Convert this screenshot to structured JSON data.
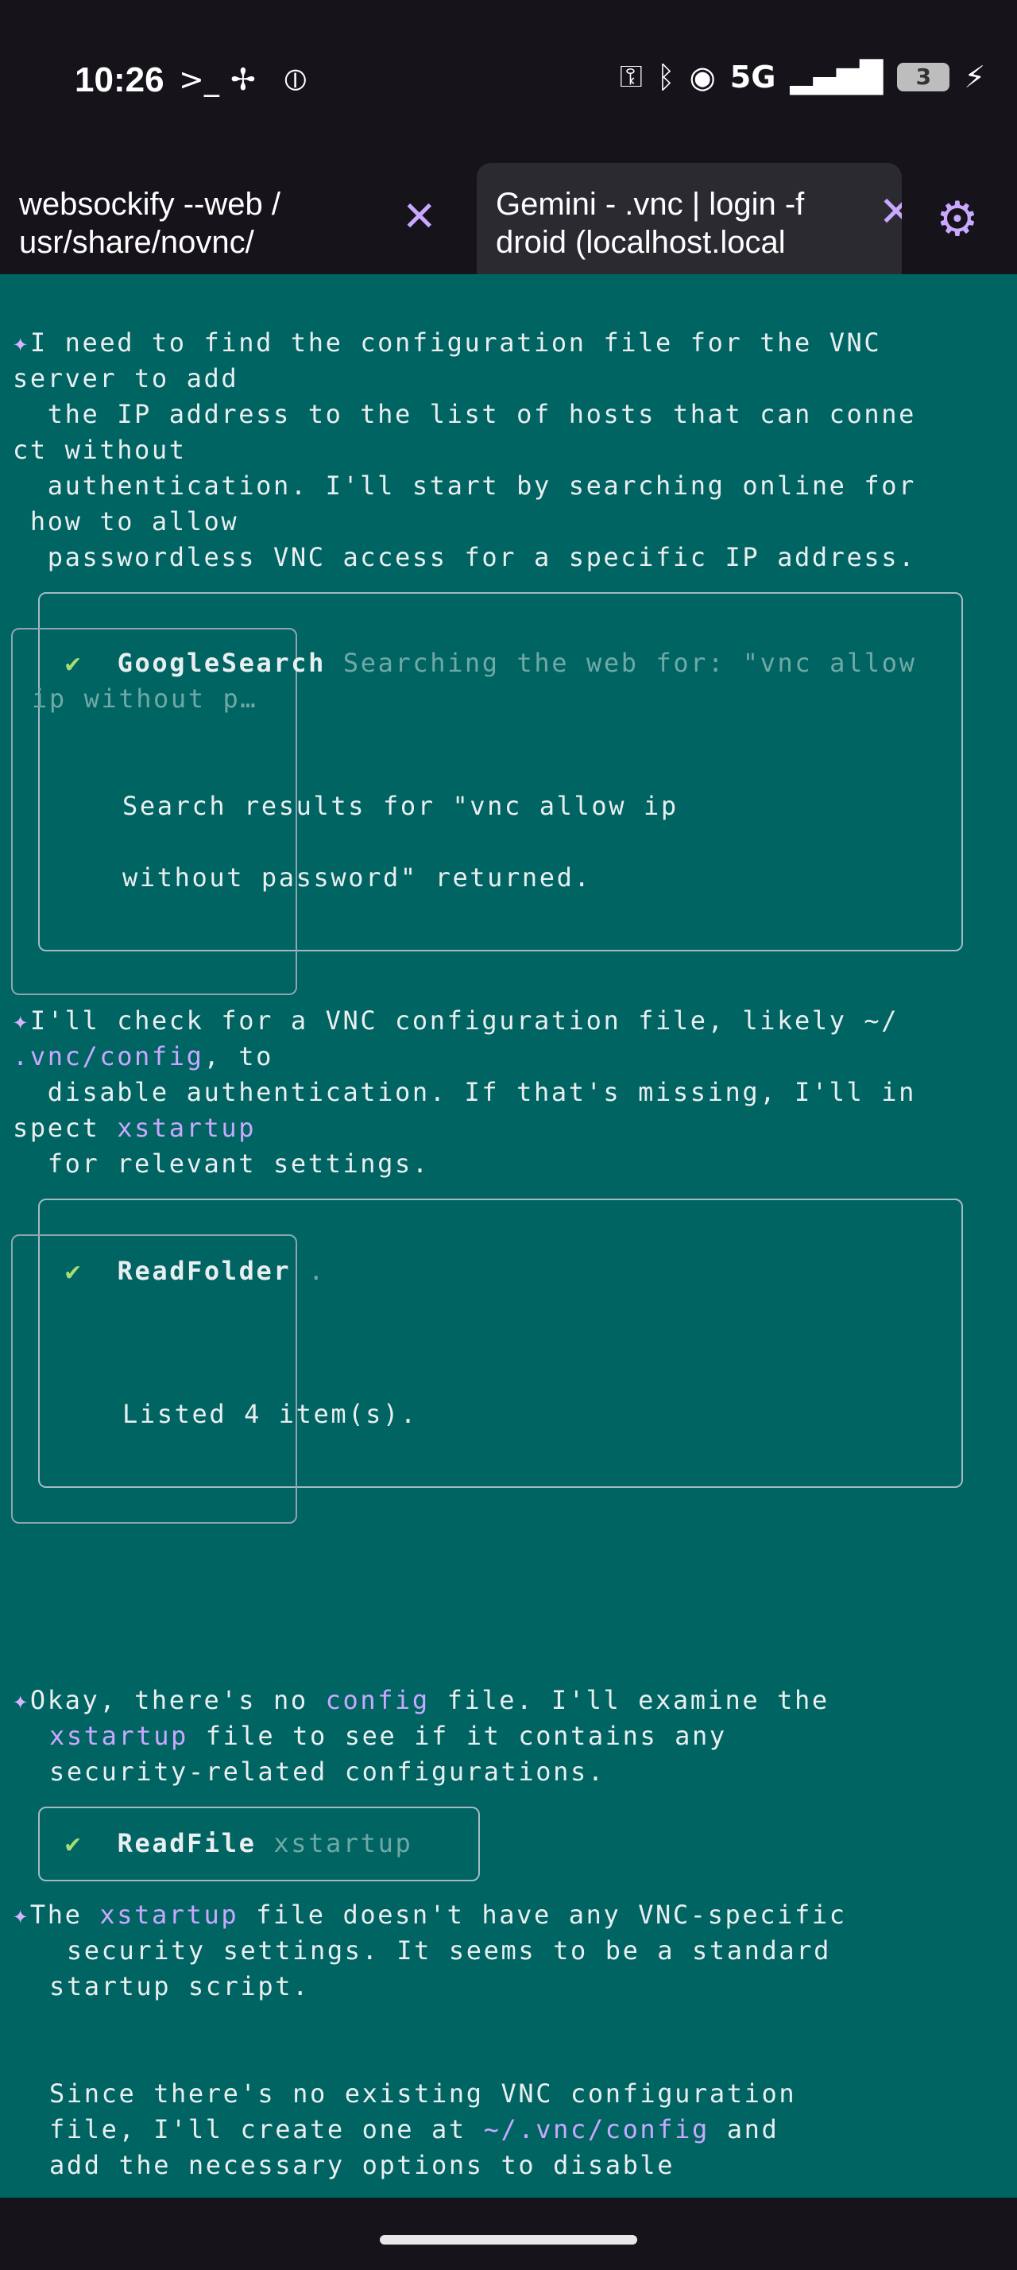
{
  "status": {
    "time": "10:26",
    "network": "5G",
    "battery": "3",
    "icons_left": [
      "terminal-prompt-icon",
      "fan-icon",
      "t-circle-icon"
    ],
    "icons_right": [
      "key-icon",
      "bluetooth-icon",
      "hotspot-icon",
      "signal-icon",
      "charging-icon"
    ]
  },
  "tabs": [
    {
      "label": "websockify --web /\nusr/share/novnc/"
    },
    {
      "label": "Gemini - .vnc | login -f\ndroid (localhost.local"
    }
  ],
  "terminal": {
    "block1": [
      "I need to find the configuration file for the VNC",
      "server to add",
      "  the IP address to the list of hosts that can conne",
      "ct without",
      "  authentication. I'll start by searching online for",
      " how to allow",
      "  passwordless VNC access for a specific IP address."
    ],
    "tool1": {
      "name": "GoogleSearch",
      "args_line1": "Searching the web for: \"vnc allow",
      "args_line2": "ip without p…",
      "result_line1": "Search results for \"vnc allow ip",
      "result_line2": "without password\" returned."
    },
    "block2": [
      "I'll check for a VNC configuration file, likely ~/",
      ".vnc/config",
      ", to",
      "  disable authentication. If that's missing, I'll in",
      "spect ",
      "xstartup",
      "  for relevant settings."
    ],
    "tool2": {
      "name": "ReadFolder",
      "args": ".",
      "result": "Listed 4 item(s)."
    },
    "block3": {
      "line1_a": "Okay, there's no ",
      "line1_b": "config",
      "line1_c": " file. I'll examine the",
      "line2_a": "xstartup",
      "line2_b": " file to see if it contains any",
      "line3": "security-related configurations."
    },
    "tool3": {
      "name": "ReadFile",
      "args": "xstartup"
    },
    "block4": {
      "line1_a": "The ",
      "line1_b": "xstartup",
      "line1_c": " file doesn't have any VNC-specific",
      "line2": " security settings. It seems to be a standard",
      "line3": "startup script.",
      "line4": "Since there's no existing VNC configuration",
      "line5_a": "file, I'll create one at ",
      "line5_b": "~/.vnc/config",
      "line5_c": " and",
      "line6": "add the necessary options to disable"
    },
    "star_glyph": "✦",
    "check_glyph": "✔"
  },
  "colors": {
    "terminal_bg": "#006462",
    "status_bg": "#16131b",
    "accent": "#c9a8ff",
    "check": "#a6df71"
  }
}
